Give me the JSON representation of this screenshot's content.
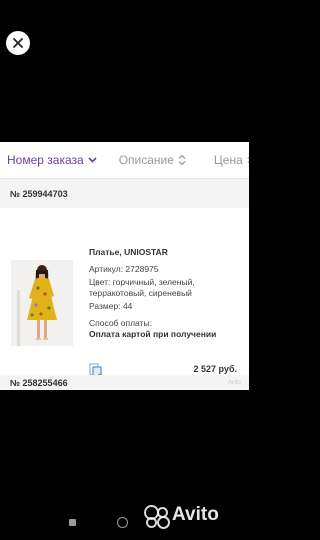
{
  "sort_bar": {
    "order_number": "Номер заказа",
    "description": "Описание",
    "price": "Цена"
  },
  "order1": {
    "number": "№ 259944703",
    "product_name": "Платье, UNIOSTAR",
    "article": "Артикул: 2728975",
    "color": "Цвет: горчичный, зеленый, терракотовый, сиреневый",
    "size": "Размер: 44",
    "payment_title": "Способ оплаты:",
    "payment_value": "Оплата картой при получении",
    "price": "2 527 руб."
  },
  "order2": {
    "number": "№ 258255466"
  },
  "watermark": "Avito",
  "colors": {
    "accent": "#6b3fa0",
    "muted": "#9a9a9a"
  }
}
